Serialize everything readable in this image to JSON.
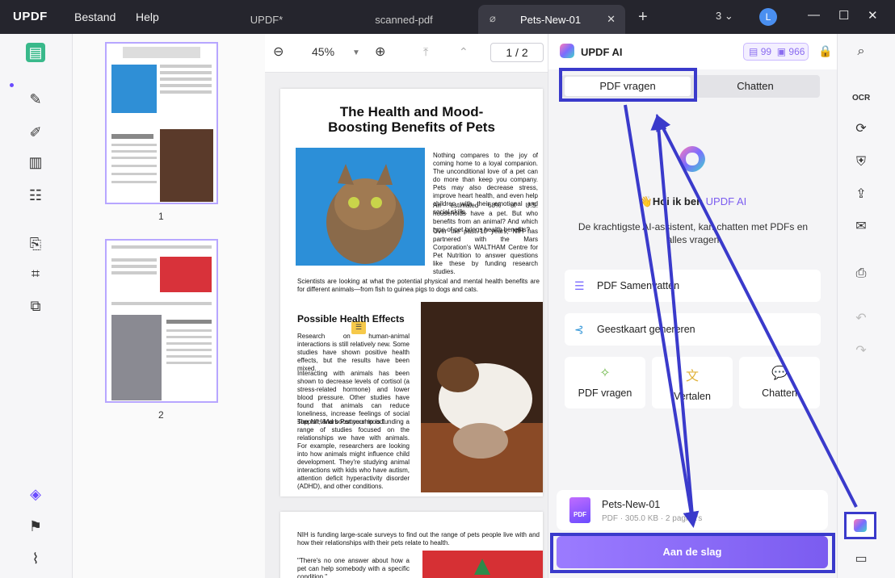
{
  "titlebar": {
    "logo": "UPDF",
    "menu": [
      "Bestand",
      "Help"
    ],
    "tabs": [
      "UPDF*",
      "scanned-pdf",
      "Pets-New-01"
    ],
    "window_count": "3",
    "avatar": "L"
  },
  "viewer": {
    "zoom": "45%",
    "page_indicator": "1 / 2",
    "thumb_numbers": [
      "1",
      "2"
    ]
  },
  "document": {
    "title": "The Health and Mood-Boosting Benefits of Pets",
    "intro": "Nothing compares to the joy of coming home to a loyal companion. The unconditional love of a pet can do more than keep you company. Pets may also decrease stress, improve heart health, and even help children with their emotional and social skills.",
    "stat": "An estimated 68% of U.S. households have a pet. But who benefits from an animal? And which type of pet brings health benefits?",
    "nih": "Over the past 10 years, NIH has partnered with the Mars Corporation's WALTHAM Centre for Pet Nutrition to answer questions like these by funding research studies.",
    "scientists": "Scientists are looking at what the potential physical and mental health benefits are for different animals—from fish to guinea pigs to dogs and cats.",
    "h_effects": "Possible Health Effects",
    "effects_1": "Research on human-animal interactions is still relatively new. Some studies have shown positive health effects, but the results have been mixed.",
    "effects_2": "Interacting with animals has been shown to decrease levels of cortisol (a stress-related hormone) and lower blood pressure. Other studies have found that animals can reduce loneliness, increase feelings of social support, and boost your mood.",
    "effects_3": "The NIH/Mars Partnership is funding a range of studies focused on the relationships we have with animals. For example, researchers are looking into how animals might influence child development. They're studying animal interactions with kids who have autism, attention deficit hyperactivity disorder (ADHD), and other conditions.",
    "page2_1": "NIH is funding large-scale surveys to find out the range of pets people live with and how their relationships with their pets relate to health.",
    "page2_2": "\"There's no one answer about how a pet can help somebody with a specific condition,\""
  },
  "ai": {
    "title": "UPDF AI",
    "credits_a": "99",
    "credits_b": "966",
    "seg_ask": "PDF vragen",
    "seg_chat": "Chatten",
    "hello_prefix": "👋Hoi ik ben",
    "hello_brand": "UPDF AI",
    "subtitle": "De krachtigste AI-assistent, kan chatten met PDFs en alles vragen",
    "opt_summary": "PDF Samenvatten",
    "opt_mindmap": "Geestkaart genereren",
    "card_ask": "PDF vragen",
    "card_translate": "Vertalen",
    "card_chat": "Chatten",
    "file_name": "Pets-New-01",
    "file_meta": "PDF · 305.0 KB · 2 pagina's",
    "file_badge": "PDF",
    "start": "Aan de slag"
  },
  "colors": {
    "accent": "#7b5cf0",
    "annotation": "#3a3acb",
    "active_tool": "#39b98b"
  }
}
